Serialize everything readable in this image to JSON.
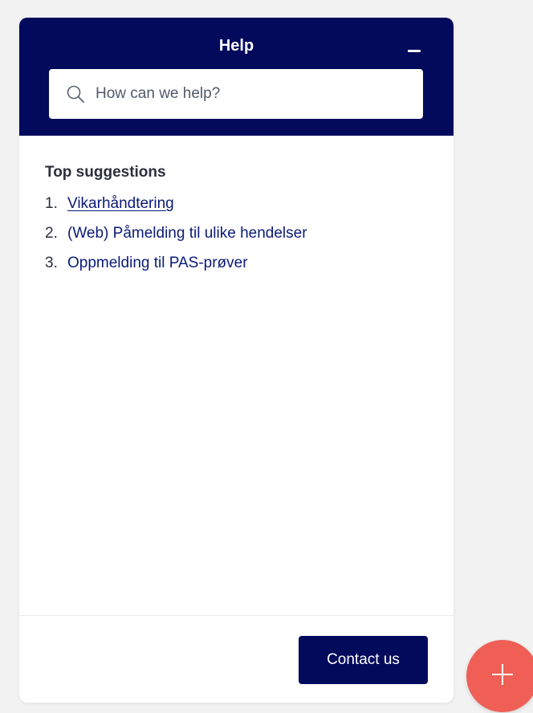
{
  "widget": {
    "title": "Help",
    "search": {
      "placeholder": "How can we help?",
      "value": ""
    },
    "suggestions": {
      "title": "Top suggestions",
      "items": [
        {
          "number": "1.",
          "label": "Vikarhåndtering"
        },
        {
          "number": "2.",
          "label": "(Web) Påmelding til ulike hendelser"
        },
        {
          "number": "3.",
          "label": "Oppmelding til PAS-prøver"
        }
      ]
    },
    "footer": {
      "contact_label": "Contact us"
    }
  },
  "icons": {
    "minimize": "minimize-icon",
    "search": "search-icon",
    "fab": "plus-icon"
  },
  "colors": {
    "brand_navy": "#020a5c",
    "link": "#0b1a78",
    "fab": "#ef5f55",
    "page_background": "#f2f2f2"
  }
}
